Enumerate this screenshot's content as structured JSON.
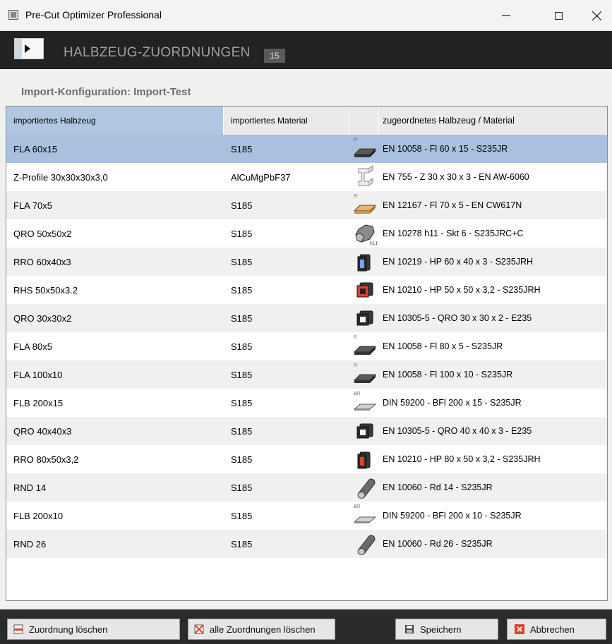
{
  "window": {
    "title": "Pre-Cut Optimizer Professional"
  },
  "header": {
    "title": "HALBZEUG-ZUORDNUNGEN",
    "count": "15"
  },
  "section": {
    "title": "Import-Konfiguration: Import-Test"
  },
  "table": {
    "columns": [
      "importiertes Halbzeug",
      "importiertes Material",
      "",
      "zugeordnetes Halbzeug / Material"
    ],
    "rows": [
      {
        "halbzeug": "FLA 60x15",
        "material": "S185",
        "icon": "flat-bar-icon",
        "icon_label": "Fl",
        "assigned": "EN 10058 - Fl 60 x 15 - S235JR"
      },
      {
        "halbzeug": "Z-Profile 30x30x30x3,0",
        "material": "AlCuMgPbF37",
        "icon": "z-profile-icon",
        "icon_label": "",
        "assigned": "EN 755 - Z 30 x 30 x 3 - EN AW-6060"
      },
      {
        "halbzeug": "FLA 70x5",
        "material": "S185",
        "icon": "flat-bar-brass-icon",
        "icon_label": "Fl",
        "assigned": "EN 12167 - Fl 70 x 5 - EN CW617N"
      },
      {
        "halbzeug": "QRO 50x50x2",
        "material": "S185",
        "icon": "hex-bar-icon",
        "icon_label": "h11",
        "assigned": "EN 10278 h11 - Skt 6 - S235JRC+C"
      },
      {
        "halbzeug": "RRO 60x40x3",
        "material": "S185",
        "icon": "rect-tube-blue-icon",
        "icon_label": "",
        "assigned": "EN 10219 - HP 60 x 40 x 3 - S235JRH"
      },
      {
        "halbzeug": "RHS 50x50x3.2",
        "material": "S185",
        "icon": "square-tube-red-icon",
        "icon_label": "",
        "assigned": "EN 10210 - HP 50 x 50 x 3,2 - S235JRH"
      },
      {
        "halbzeug": "QRO 30x30x2",
        "material": "S185",
        "icon": "square-tube-icon",
        "icon_label": "",
        "assigned": "EN 10305-5 - QRO 30 x 30 x 2 - E235"
      },
      {
        "halbzeug": "FLA 80x5",
        "material": "S185",
        "icon": "flat-bar-icon",
        "icon_label": "Fl",
        "assigned": "EN 10058 - Fl 80 x 5 - S235JR"
      },
      {
        "halbzeug": "FLA 100x10",
        "material": "S185",
        "icon": "flat-bar-icon",
        "icon_label": "Fl",
        "assigned": "EN 10058 - Fl 100 x 10 - S235JR"
      },
      {
        "halbzeug": "FLB 200x15",
        "material": "S185",
        "icon": "wide-flat-bar-icon",
        "icon_label": "BFl",
        "assigned": "DIN 59200 - BFl 200 x 15 - S235JR"
      },
      {
        "halbzeug": "QRO 40x40x3",
        "material": "S185",
        "icon": "square-tube-icon",
        "icon_label": "",
        "assigned": "EN 10305-5 - QRO 40 x 40 x 3 - E235"
      },
      {
        "halbzeug": "RRO 80x50x3,2",
        "material": "S185",
        "icon": "rect-tube-red-icon",
        "icon_label": "",
        "assigned": "EN 10210 - HP 80 x 50 x 3,2 - S235JRH"
      },
      {
        "halbzeug": "RND 14",
        "material": "S185",
        "icon": "round-bar-icon",
        "icon_label": "",
        "assigned": "EN 10060 - Rd 14 - S235JR"
      },
      {
        "halbzeug": "FLB 200x10",
        "material": "S185",
        "icon": "wide-flat-bar-icon",
        "icon_label": "BFl",
        "assigned": "DIN 59200 - BFl 200 x 10 - S235JR"
      },
      {
        "halbzeug": "RND 26",
        "material": "S185",
        "icon": "round-bar-icon",
        "icon_label": "",
        "assigned": "EN 10060 - Rd 26 - S235JR"
      }
    ],
    "selected_index": 0
  },
  "footer": {
    "delete_label": "Zuordnung löschen",
    "delete_all_label": "alle Zuordnungen löschen",
    "save_label": "Speichern",
    "cancel_label": "Abbrechen"
  },
  "colors": {
    "selected_row": "#a9c1de",
    "header_bg": "#222222",
    "accent_red": "#e0402a"
  }
}
